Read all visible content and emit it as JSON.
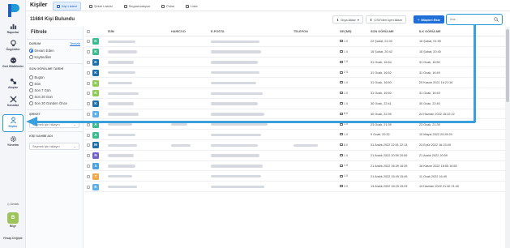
{
  "app": {
    "title": "Kişiler"
  },
  "rail": {
    "items": [
      {
        "label": "Raporlar",
        "icon": "bar-chart-icon"
      },
      {
        "label": "Öngörüler",
        "icon": "lightbulb-icon"
      },
      {
        "label": "Geri Bildirimler",
        "icon": "feedback-icon"
      },
      {
        "label": "Akışlar",
        "icon": "flow-icon"
      },
      {
        "label": "Kanallar",
        "icon": "channels-icon"
      },
      {
        "label": "Kişiler",
        "icon": "user-icon"
      },
      {
        "label": "Yönetim",
        "icon": "gear-icon"
      }
    ],
    "help": "Destek",
    "avatar_letter": "B",
    "account_name": "Bilge",
    "account_switch": "Hesap Değiştir"
  },
  "tabs": [
    {
      "label": "Kişi Listesi",
      "active": true
    },
    {
      "label": "Şirket Listesi",
      "active": false
    },
    {
      "label": "Segmentasyon",
      "active": false
    },
    {
      "label": "Pulse",
      "active": false
    },
    {
      "label": "Liste",
      "active": false
    }
  ],
  "header": {
    "count_text": "11684 Kişi Bulundu",
    "export_label": "Dışa Aktar",
    "import_label": "CSV'den İçeri Aktar",
    "add_label": "Müşteri Ekle",
    "search_placeholder": "Ara..."
  },
  "filters": {
    "title": "Filtrele",
    "status_label": "DURUM",
    "clear_label": "Temizle",
    "status_options": [
      {
        "label": "Devam Eden",
        "checked": true
      },
      {
        "label": "Kaybedilen",
        "checked": false
      }
    ],
    "last_seen_label": "SON GÖRÜLME TARİHİ",
    "last_seen_options": [
      "Bugün",
      "Dün",
      "Son 7 Gün",
      "Son 30 Gün",
      "Son 30 Günden Önce"
    ],
    "company_label": "ŞİRKET",
    "company_placeholder": "Seçmek için tıklayın",
    "agent_label": "KİŞİ SAHİBİ ADI",
    "agent_placeholder": "Seçmek için tıklayın"
  },
  "table": {
    "columns": [
      "İSİM",
      "HARİCİ ID",
      "E-POSTA",
      "TELEFON",
      "SEÇMİŞ",
      "SON GÖRÜLME",
      "İLK GÖRÜLME"
    ],
    "rows": [
      {
        "letter": "K",
        "color": "#3dbb8f",
        "sel": "1 0",
        "last": "22 Şubat, 21:00",
        "first": "16 Şubat, 01:59"
      },
      {
        "letter": "K",
        "color": "#3dbb8f",
        "sel": "1 0",
        "last": "16 Şubat, 20:42",
        "first": "16 Şubat, 20:40"
      },
      {
        "letter": "K",
        "color": "#1f6fa9",
        "sel": "1 0",
        "last": "31 Ocak, 16:54",
        "first": "31 Ocak, 16:50"
      },
      {
        "letter": "K",
        "color": "#1f6fa9",
        "sel": "2 0",
        "last": "31 Ocak, 16:52",
        "first": "31 Ocak, 16:49"
      },
      {
        "letter": "K",
        "color": "#8fc95a",
        "sel": "1 0",
        "last": "31 Ocak, 16:50",
        "first": "29 Kasım 2021 16:21:16"
      },
      {
        "letter": "K",
        "color": "#8fc95a",
        "sel": "1 0",
        "last": "31 Ocak, 16:50",
        "first": "31 Ocak, 16:49"
      },
      {
        "letter": "K",
        "color": "#1f6fa9",
        "sel": "1 0",
        "last": "30 Ocak, 22:41",
        "first": "30 Ocak, 22:40"
      },
      {
        "letter": "E",
        "color": "#5fb0e8",
        "sel": "6 0",
        "last": "30 Ocak, 22:39",
        "first": "24 Haziran 2022 18:22:22"
      },
      {
        "letter": "A",
        "color": "#3dbb8f",
        "sel": "1 0",
        "last": "23 Ocak, 21:39",
        "first": "23 Ocak, 21:39"
      },
      {
        "letter": "A",
        "color": "#3dbb8f",
        "sel": "1 0",
        "last": "9 Ocak, 20:32",
        "first": "10 Mayıs 2022 20:28:29"
      },
      {
        "letter": "M",
        "color": "#1f6fa9",
        "sel": "6 0",
        "last": "31 Aralık 2022 22:51 22:13",
        "first": "23 Eylül 2022 16:15:49"
      },
      {
        "letter": "N",
        "color": "#6f62c8",
        "sel": "1 0",
        "last": "21 Aralık 2022 20:59 20:59",
        "first": "21 Aralık 2022 20:59"
      },
      {
        "letter": "S",
        "color": "#4aa3dc",
        "sel": "1 0",
        "last": "21 Aralık 2022 16:39 16:39",
        "first": "16 Kasım 2022 18:55 16:55"
      },
      {
        "letter": "T",
        "color": "#f0a94a",
        "sel": "1 0",
        "last": "21 Aralık 2022 15:49 15:49",
        "first": "11 Ocak 2022 16:49"
      },
      {
        "letter": "E",
        "color": "#5fb0e8",
        "sel": "3 0",
        "last": "13 Aralık 2022 15:29 15:29",
        "first": "14 Haziran 2022 21:40 21:40"
      }
    ]
  }
}
